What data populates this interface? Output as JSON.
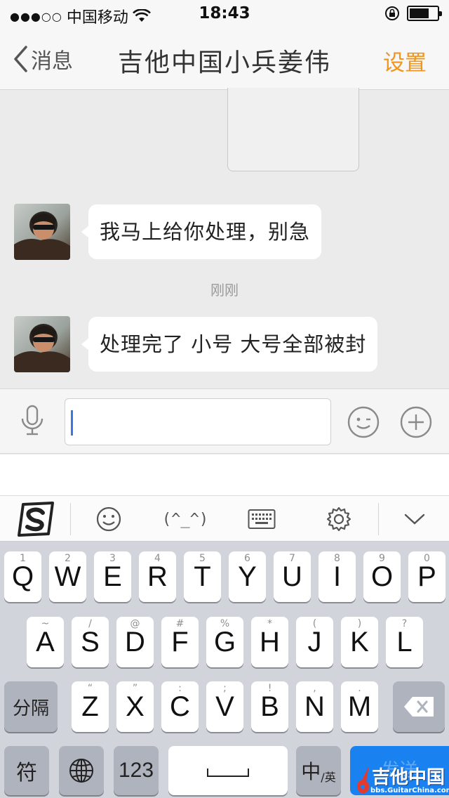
{
  "status_bar": {
    "signal": "●●●○○",
    "carrier": "中国移动",
    "time": "18:43"
  },
  "nav": {
    "back_label": "消息",
    "title": "吉他中国小兵姜伟",
    "settings_label": "设置"
  },
  "messages": [
    {
      "text": "我马上给你处理，别急"
    },
    {
      "text": "处理完了 小号 大号全部被封"
    }
  ],
  "timestamp": "刚刚",
  "ime_toolbar": {
    "kaomoji": "(^_^)"
  },
  "keyboard": {
    "row1": [
      {
        "ch": "Q",
        "hint": "1"
      },
      {
        "ch": "W",
        "hint": "2"
      },
      {
        "ch": "E",
        "hint": "3"
      },
      {
        "ch": "R",
        "hint": "4"
      },
      {
        "ch": "T",
        "hint": "5"
      },
      {
        "ch": "Y",
        "hint": "6"
      },
      {
        "ch": "U",
        "hint": "7"
      },
      {
        "ch": "I",
        "hint": "8"
      },
      {
        "ch": "O",
        "hint": "9"
      },
      {
        "ch": "P",
        "hint": "0"
      }
    ],
    "row2": [
      {
        "ch": "A",
        "hint": "~"
      },
      {
        "ch": "S",
        "hint": "/"
      },
      {
        "ch": "D",
        "hint": "@"
      },
      {
        "ch": "F",
        "hint": "#"
      },
      {
        "ch": "G",
        "hint": "%"
      },
      {
        "ch": "H",
        "hint": "*"
      },
      {
        "ch": "J",
        "hint": "("
      },
      {
        "ch": "K",
        "hint": ")"
      },
      {
        "ch": "L",
        "hint": "?"
      }
    ],
    "row3": [
      {
        "ch": "Z",
        "hint": "“"
      },
      {
        "ch": "X",
        "hint": "”"
      },
      {
        "ch": "C",
        "hint": ":"
      },
      {
        "ch": "V",
        "hint": ";"
      },
      {
        "ch": "B",
        "hint": "!"
      },
      {
        "ch": "N",
        "hint": ","
      },
      {
        "ch": "M",
        "hint": "."
      }
    ],
    "separator_label": "分隔",
    "symbol_label": "符",
    "numbers_label": "123",
    "lang_main": "中",
    "lang_sub": "/英",
    "send_label": "发送"
  },
  "watermark": {
    "title": "吉他中国",
    "url": "bbs.GuitarChina.com"
  },
  "colors": {
    "accent": "#f0951e",
    "send": "#1a82f0",
    "caret": "#3b76e1"
  }
}
